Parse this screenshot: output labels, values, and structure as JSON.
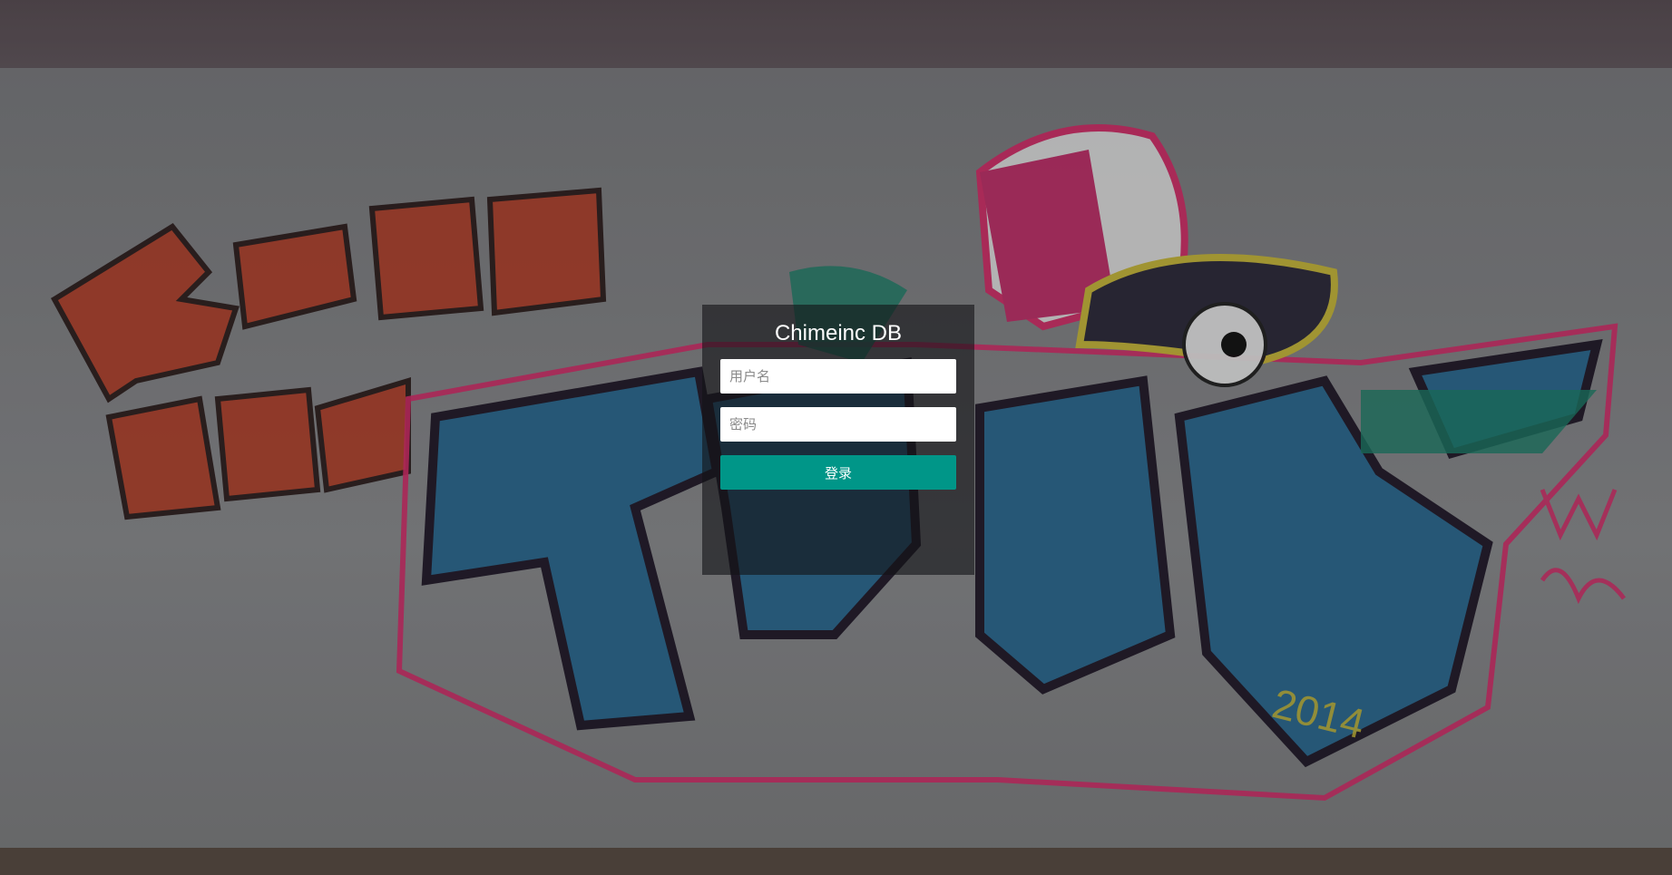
{
  "login": {
    "title": "Chimeinc DB",
    "username_placeholder": "用户名",
    "password_placeholder": "密码",
    "submit_label": "登录"
  },
  "theme": {
    "accent": "#009688",
    "panel_bg": "rgba(20,20,22,0.62)"
  },
  "background": {
    "description_icon": "graffiti-wall-image"
  }
}
